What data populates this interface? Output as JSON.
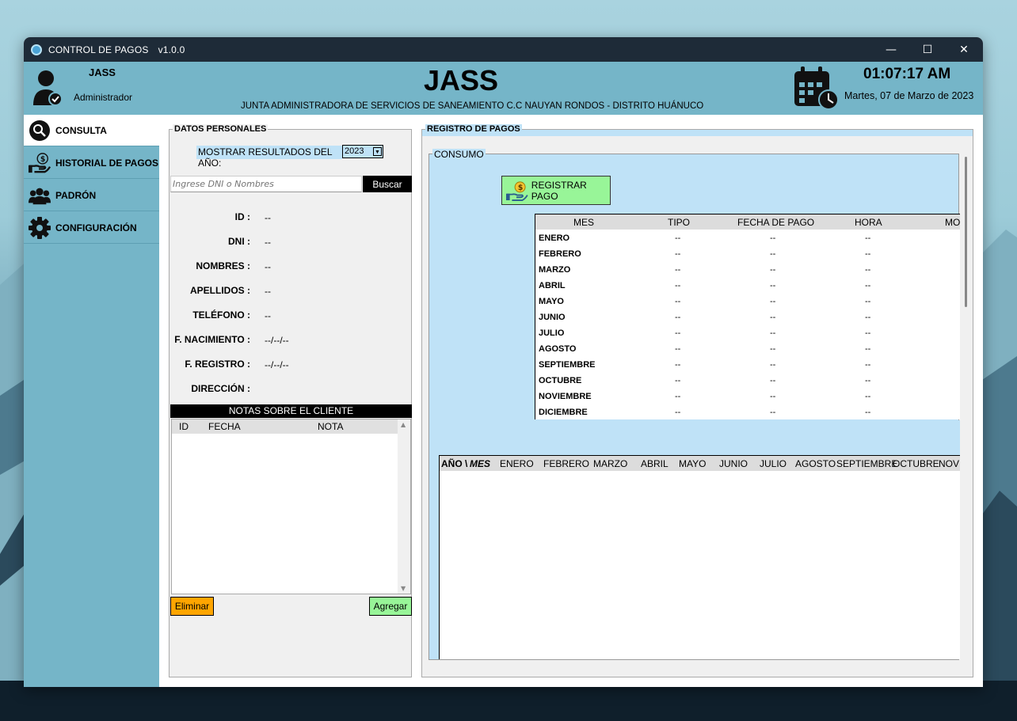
{
  "window": {
    "title": "CONTROL DE PAGOS",
    "version": "v1.0.0",
    "controls": {
      "minimize": "—",
      "maximize": "☐",
      "close": "✕"
    }
  },
  "header": {
    "user": "JASS",
    "role": "Administrador",
    "title": "JASS",
    "subtitle": "JUNTA ADMINISTRADORA DE SERVICIOS DE SANEAMIENTO C.C NAUYAN RONDOS - DISTRITO HUÁNUCO",
    "time": "01:07:17  AM",
    "date": "Martes, 07 de Marzo de 2023"
  },
  "sidebar": {
    "items": [
      {
        "label": "CONSULTA",
        "icon": "search-icon"
      },
      {
        "label": "HISTORIAL DE PAGOS",
        "icon": "money-hand-icon"
      },
      {
        "label": "PADRÓN",
        "icon": "users-icon"
      },
      {
        "label": "CONFIGURACIÓN",
        "icon": "gear-icon"
      }
    ]
  },
  "personal": {
    "legend": "DATOS PERSONALES",
    "year_label": "MOSTRAR RESULTADOS DEL AÑO:",
    "year_value": "2023",
    "search_placeholder": "Ingrese DNI o Nombres",
    "search_button": "Buscar",
    "fields": [
      {
        "label": "ID :",
        "value": "--"
      },
      {
        "label": "DNI :",
        "value": "--"
      },
      {
        "label": "NOMBRES :",
        "value": "--"
      },
      {
        "label": "APELLIDOS :",
        "value": "--"
      },
      {
        "label": "TELÉFONO :",
        "value": "--"
      },
      {
        "label": "F. NACIMIENTO :",
        "value": "--/--/--"
      },
      {
        "label": "F. REGISTRO :",
        "value": "--/--/--"
      },
      {
        "label": "DIRECCIÓN :",
        "value": ""
      }
    ],
    "notes_title": "NOTAS SOBRE EL CLIENTE",
    "notes_columns": [
      "ID",
      "FECHA",
      "NOTA"
    ],
    "delete_button": "Eliminar",
    "add_button": "Agregar"
  },
  "registro": {
    "legend": "REGISTRO DE PAGOS",
    "consumo_legend": "CONSUMO",
    "register_button": "REGISTRAR PAGO",
    "columns": [
      "MES",
      "TIPO",
      "FECHA DE PAGO",
      "HORA",
      "MO"
    ],
    "rows": [
      {
        "mes": "ENERO",
        "tipo": "--",
        "fecha": "--",
        "hora": "--"
      },
      {
        "mes": "FEBRERO",
        "tipo": "--",
        "fecha": "--",
        "hora": "--"
      },
      {
        "mes": "MARZO",
        "tipo": "--",
        "fecha": "--",
        "hora": "--"
      },
      {
        "mes": "ABRIL",
        "tipo": "--",
        "fecha": "--",
        "hora": "--"
      },
      {
        "mes": "MAYO",
        "tipo": "--",
        "fecha": "--",
        "hora": "--"
      },
      {
        "mes": "JUNIO",
        "tipo": "--",
        "fecha": "--",
        "hora": "--"
      },
      {
        "mes": "JULIO",
        "tipo": "--",
        "fecha": "--",
        "hora": "--"
      },
      {
        "mes": "AGOSTO",
        "tipo": "--",
        "fecha": "--",
        "hora": "--"
      },
      {
        "mes": "SEPTIEMBRE",
        "tipo": "--",
        "fecha": "--",
        "hora": "--"
      },
      {
        "mes": "OCTUBRE",
        "tipo": "--",
        "fecha": "--",
        "hora": "--"
      },
      {
        "mes": "NOVIEMBRE",
        "tipo": "--",
        "fecha": "--",
        "hora": "--"
      },
      {
        "mes": "DICIEMBRE",
        "tipo": "--",
        "fecha": "--",
        "hora": "--"
      }
    ],
    "history_corner": "AÑO \\",
    "history_corner_b": "MES",
    "history_columns": [
      "ENERO",
      "FEBRERO",
      "MARZO",
      "ABRIL",
      "MAYO",
      "JUNIO",
      "JULIO",
      "AGOSTO",
      "SEPTIEMBRE",
      "OCTUBRE",
      "NOV"
    ]
  },
  "colors": {
    "accent": "#75b5c8",
    "titlebar": "#1e2b38",
    "panel_blue": "#bfe2f7",
    "green_btn": "#98f598",
    "orange_btn": "#ffa500"
  }
}
